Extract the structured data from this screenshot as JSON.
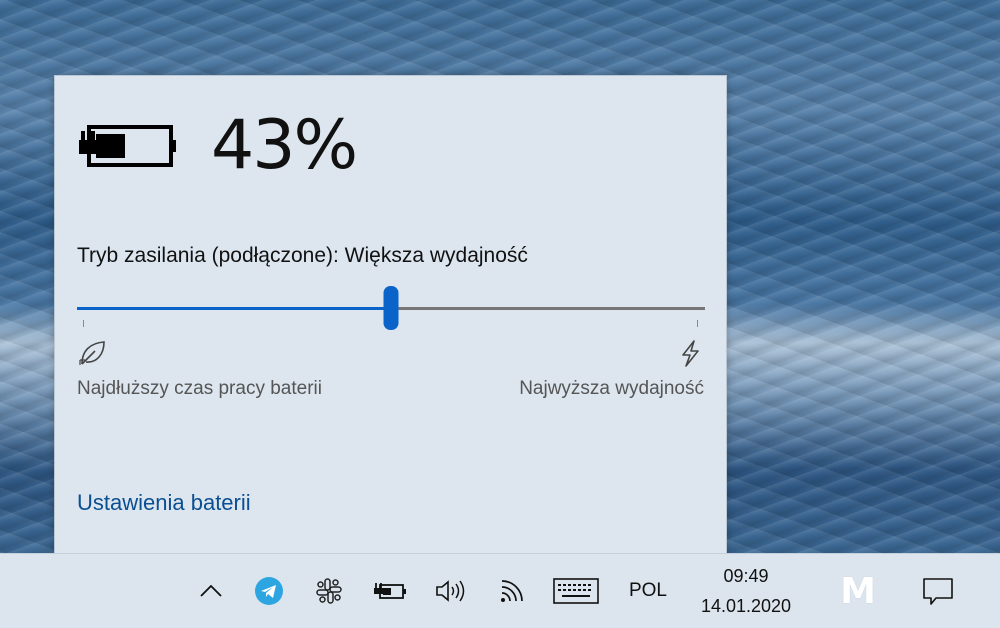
{
  "flyout": {
    "battery_percent": "43%",
    "battery_level": 0.43,
    "battery_icon": "battery-charging-icon",
    "power_mode_label": "Tryb zasilania (podłączone): Większa wydajność",
    "slider": {
      "value_fraction": 0.5,
      "left_label": "Najdłuższy czas pracy baterii",
      "right_label": "Najwyższa wydajność",
      "left_icon": "leaf-icon",
      "right_icon": "lightning-icon"
    },
    "settings_link": "Ustawienia baterii"
  },
  "taskbar": {
    "icons": [
      "chevron-up-icon",
      "telegram-icon",
      "slack-icon",
      "battery-icon",
      "volume-icon",
      "wifi-icon",
      "keyboard-icon",
      "action-center-icon"
    ],
    "language": "POL",
    "time": "09:49",
    "date": "14.01.2020",
    "brand_logo_text": "M"
  },
  "colors": {
    "accent": "#0a63c9",
    "link": "#0a4f91",
    "flyout_bg": "#dde6ef",
    "taskbar_bg": "#dce5ee",
    "telegram": "#2ca5e0"
  }
}
